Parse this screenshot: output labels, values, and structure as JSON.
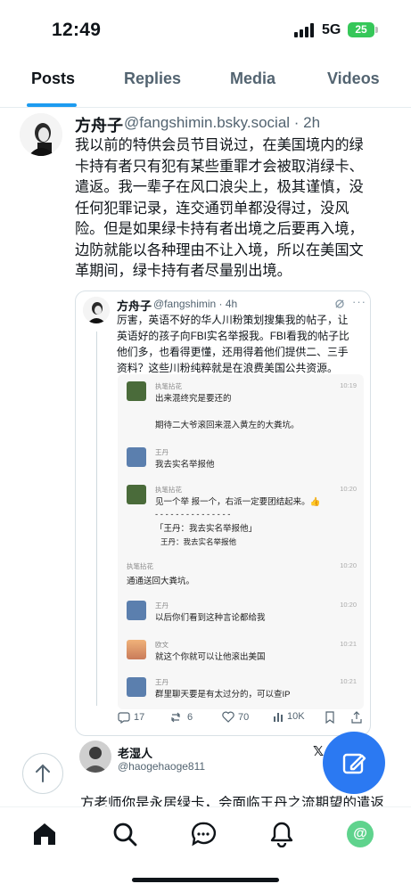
{
  "status_bar": {
    "time": "12:49",
    "network": "5G",
    "battery": "25"
  },
  "tabs": [
    {
      "label": "Posts",
      "active": true
    },
    {
      "label": "Replies",
      "active": false
    },
    {
      "label": "Media",
      "active": false
    },
    {
      "label": "Videos",
      "active": false
    }
  ],
  "post": {
    "name": "方舟子",
    "handle_time": "@fangshimin.bsky.social · 2h",
    "lines": [
      "我以前的特供会员节目说过，在美国境内的绿",
      "卡持有者只有犯有某些重罪才会被取消绿卡、",
      "遣返。我一辈子在风口浪尖上，极其谨慎，没",
      "任何犯罪记录，连交通罚单都没得过，没风",
      "险。但是如果绿卡持有者出境之后要再入境，",
      "边防就能以各种理由不让入境，所以在美国文",
      "革期间，绿卡持有者尽量别出境。"
    ]
  },
  "quote": {
    "name": "方舟子",
    "handle_time": "@fangshimin · 4h",
    "lines": [
      "厉害，英语不好的华人川粉策划搜集我的帖子，让",
      "英语好的孩子向FBI实名举报我。FBI看我的帖子比",
      "他们多，也看得更懂，还用得着他们提供二、三手",
      "资料？这些川粉纯粹就是在浪费美国公共资源。"
    ],
    "chat": [
      {
        "name": "执笔拈花",
        "time": "10:19",
        "text": "出来混终究是要还的",
        "text2": "期待二大爷滚回来混入黄左的大粪坑。"
      },
      {
        "name": "王丹",
        "time": "",
        "text": "我去实名举报他"
      },
      {
        "name": "执笔拈花",
        "time": "10:20",
        "text": "见一个举 报一个，右派一定要团结起来。👍",
        "text2": "- - - - - - - - - - - - - - -",
        "text3": "「王丹：我去实名举报他」",
        "text4": "王丹：我去实名举报他"
      },
      {
        "name": "执笔拈花",
        "time": "10:20",
        "text": "通通送回大粪坑。"
      },
      {
        "name": "王丹",
        "time": "10:20",
        "text": "以后你们看到这种言论都给我"
      },
      {
        "name": "欧文",
        "time": "10:21",
        "text": "就这个你就可以让他滚出美国"
      },
      {
        "name": "王丹",
        "time": "10:21",
        "text": "群里聊天要是有太过分的，可以查IP"
      }
    ],
    "actions": {
      "replies": "17",
      "reposts": "6",
      "likes": "70",
      "views": "10K"
    }
  },
  "reply": {
    "name": "老湿人",
    "handle": "@haogehaoge811",
    "text": "方老师你是永居绿卡，会面临王丹之流期望的遣返"
  },
  "colors": {
    "accent": "#1d9bf0",
    "compose": "#2b79f2",
    "battery": "#36c759"
  },
  "icons": [
    "home-icon",
    "search-icon",
    "chat-icon",
    "bell-icon",
    "at-icon",
    "compose-icon",
    "arrow-up-icon"
  ]
}
